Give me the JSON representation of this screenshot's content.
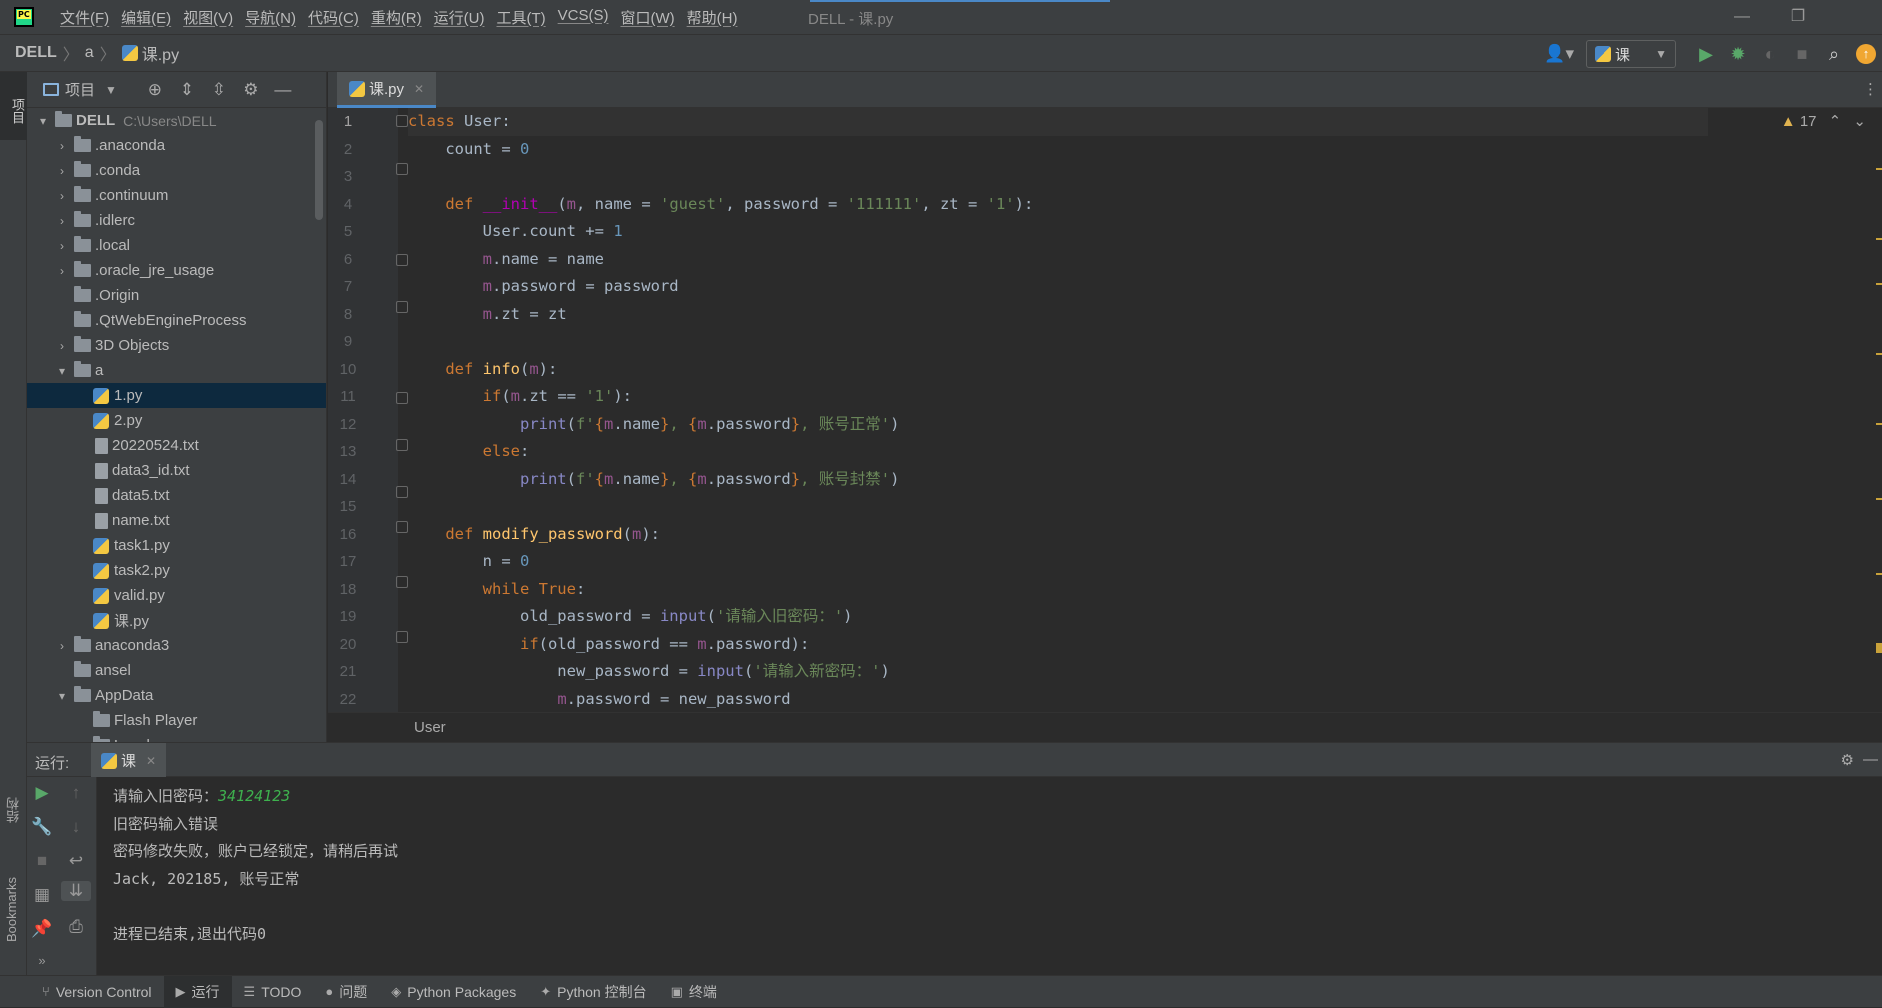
{
  "window": {
    "menu": [
      "文件(F)",
      "编辑(E)",
      "视图(V)",
      "导航(N)",
      "代码(C)",
      "重构(R)",
      "运行(U)",
      "工具(T)",
      "VCS(S)",
      "窗口(W)",
      "帮助(H)"
    ],
    "title": "DELL - 课.py"
  },
  "nav": {
    "breadcrumb": [
      "DELL",
      "a",
      "课.py"
    ],
    "run_config": "课"
  },
  "strip": {
    "project": "项目",
    "structure": "结构",
    "bookmarks": "Bookmarks"
  },
  "project": {
    "title": "项目",
    "tree": [
      {
        "indent": 0,
        "arrow": "▾",
        "type": "folder",
        "label": "DELL",
        "path": "C:\\Users\\DELL"
      },
      {
        "indent": 1,
        "arrow": "›",
        "type": "folder",
        "label": ".anaconda"
      },
      {
        "indent": 1,
        "arrow": "›",
        "type": "folder",
        "label": ".conda"
      },
      {
        "indent": 1,
        "arrow": "›",
        "type": "folder",
        "label": ".continuum"
      },
      {
        "indent": 1,
        "arrow": "›",
        "type": "folder",
        "label": ".idlerc"
      },
      {
        "indent": 1,
        "arrow": "›",
        "type": "folder",
        "label": ".local"
      },
      {
        "indent": 1,
        "arrow": "›",
        "type": "folder",
        "label": ".oracle_jre_usage"
      },
      {
        "indent": 1,
        "arrow": "",
        "type": "folder",
        "label": ".Origin"
      },
      {
        "indent": 1,
        "arrow": "",
        "type": "folder",
        "label": ".QtWebEngineProcess"
      },
      {
        "indent": 1,
        "arrow": "›",
        "type": "folder",
        "label": "3D Objects"
      },
      {
        "indent": 1,
        "arrow": "▾",
        "type": "folder",
        "label": "a"
      },
      {
        "indent": 2,
        "arrow": "",
        "type": "py",
        "label": "1.py",
        "selected": true
      },
      {
        "indent": 2,
        "arrow": "",
        "type": "py",
        "label": "2.py"
      },
      {
        "indent": 2,
        "arrow": "",
        "type": "file",
        "label": "20220524.txt"
      },
      {
        "indent": 2,
        "arrow": "",
        "type": "file",
        "label": "data3_id.txt"
      },
      {
        "indent": 2,
        "arrow": "",
        "type": "file",
        "label": "data5.txt"
      },
      {
        "indent": 2,
        "arrow": "",
        "type": "file",
        "label": "name.txt"
      },
      {
        "indent": 2,
        "arrow": "",
        "type": "py",
        "label": "task1.py"
      },
      {
        "indent": 2,
        "arrow": "",
        "type": "py",
        "label": "task2.py"
      },
      {
        "indent": 2,
        "arrow": "",
        "type": "py",
        "label": "valid.py"
      },
      {
        "indent": 2,
        "arrow": "",
        "type": "py",
        "label": "课.py"
      },
      {
        "indent": 1,
        "arrow": "›",
        "type": "folder",
        "label": "anaconda3"
      },
      {
        "indent": 1,
        "arrow": "",
        "type": "folder",
        "label": "ansel"
      },
      {
        "indent": 1,
        "arrow": "▾",
        "type": "folder",
        "label": "AppData"
      },
      {
        "indent": 2,
        "arrow": "",
        "type": "folder",
        "label": "Flash Player"
      },
      {
        "indent": 2,
        "arrow": "▾",
        "type": "folder",
        "label": "Local"
      }
    ]
  },
  "editor": {
    "tab": "课.py",
    "inspection_count": "17",
    "breadcrumb": "User",
    "line_numbers": [
      "1",
      "2",
      "3",
      "4",
      "5",
      "6",
      "7",
      "8",
      "9",
      "10",
      "11",
      "12",
      "13",
      "14",
      "15",
      "16",
      "17",
      "18",
      "19",
      "20",
      "21",
      "22"
    ]
  },
  "run": {
    "label": "运行:",
    "tab": "课",
    "output": [
      {
        "text": "请输入旧密码：",
        "input": "34124123"
      },
      {
        "text": "旧密码输入错误"
      },
      {
        "text": "密码修改失败，账户已经锁定，请稍后再试"
      },
      {
        "text": "Jack, 202185, 账号正常"
      },
      {
        "text": ""
      },
      {
        "text": "进程已结束,退出代码0"
      }
    ]
  },
  "bottom_tabs": [
    {
      "icon": "branch-icon",
      "label": "Version Control"
    },
    {
      "icon": "run-icon",
      "label": "运行",
      "active": true
    },
    {
      "icon": "list-icon",
      "label": "TODO"
    },
    {
      "icon": "problems-icon",
      "label": "问题"
    },
    {
      "icon": "packages-icon",
      "label": "Python Packages"
    },
    {
      "icon": "python-console-icon",
      "label": "Python 控制台"
    },
    {
      "icon": "terminal-icon",
      "label": "终端"
    }
  ]
}
